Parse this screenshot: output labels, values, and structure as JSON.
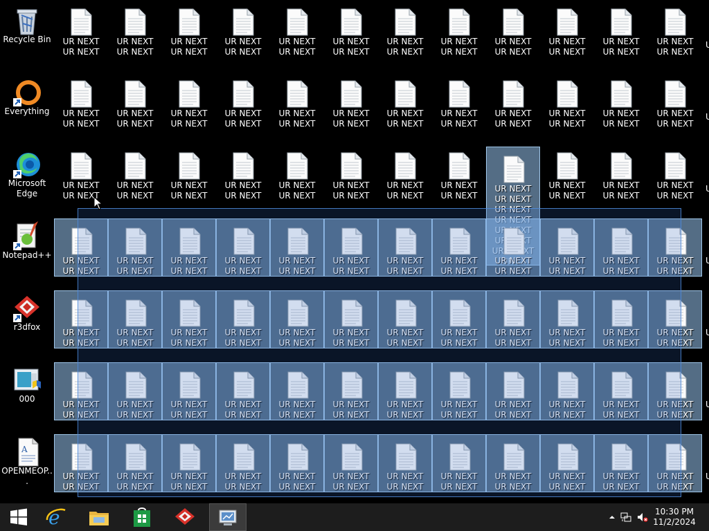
{
  "desktop": {
    "icons": [
      {
        "label": "Recycle Bin",
        "icon": "recycle-bin-icon"
      },
      {
        "label": "Everything",
        "icon": "everything-icon"
      },
      {
        "label": "Microsoft Edge",
        "icon": "edge-icon"
      },
      {
        "label": "Notepad++",
        "icon": "notepadpp-icon"
      },
      {
        "label": "r3dfox",
        "icon": "r3dfox-icon"
      },
      {
        "label": "000",
        "icon": "program-icon"
      },
      {
        "label": "OPENMEOP...",
        "icon": "document-icon"
      }
    ],
    "file_label": "UR NEXT UR NEXT UR ...",
    "focused_file_label": "UR NEXT UR NEXT UR NEXT UR NEXT UR NEXT UR NEXT UR N53XT UR ...",
    "partial_label": "U"
  },
  "taskbar": {
    "start": "windows-start-icon",
    "pinned": [
      "internet-explorer-icon",
      "file-explorer-icon",
      "store-icon",
      "r3dfox-icon",
      "control-panel-icon"
    ],
    "clock_time": "10:30 PM",
    "clock_date": "11/2/2024"
  }
}
